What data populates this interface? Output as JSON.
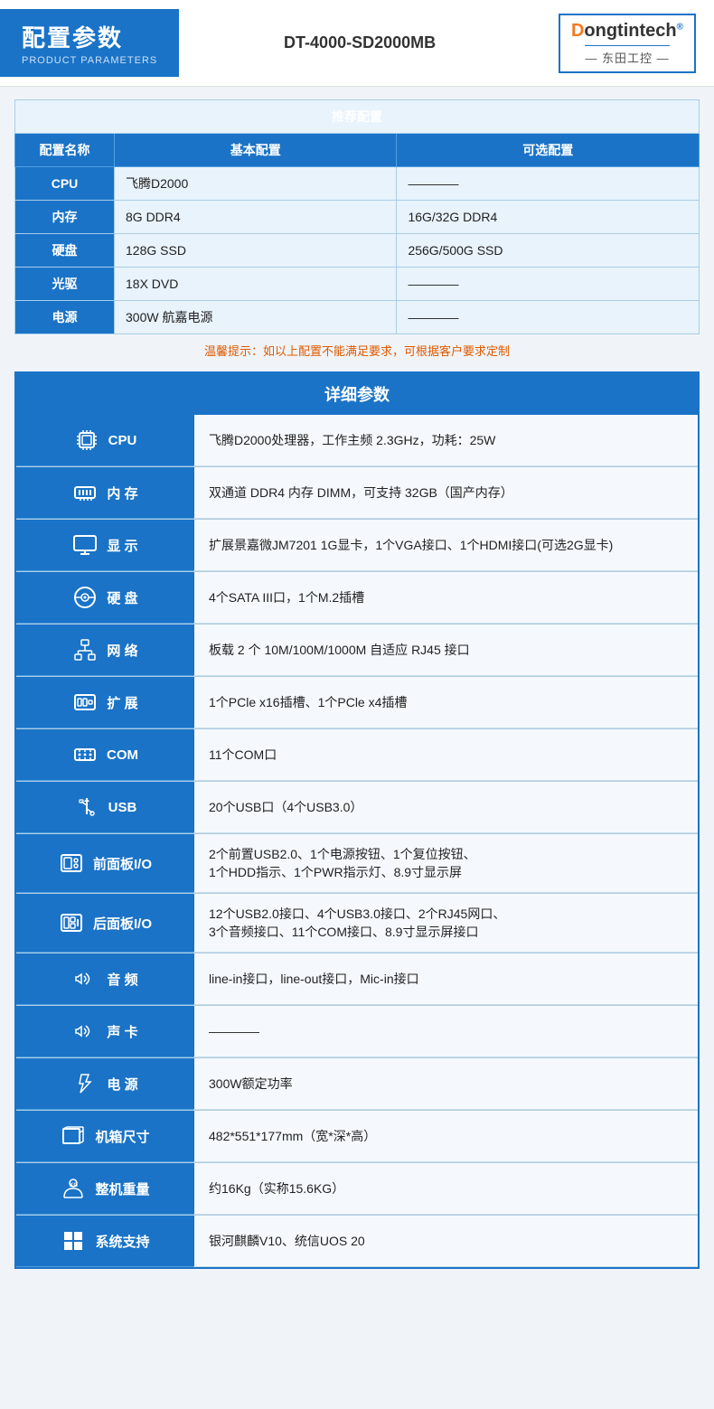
{
  "header": {
    "title_main": "配置参数",
    "title_sub": "PRODUCT PARAMETERS",
    "model": "DT-4000-SD2000MB",
    "logo_brand": "Dongtintech",
    "logo_brand_d": "D",
    "logo_chinese": "— 东田工控 —"
  },
  "recommended": {
    "section_title": "推荐配置",
    "columns": [
      "配置名称",
      "基本配置",
      "可选配置"
    ],
    "rows": [
      {
        "label": "CPU",
        "basic": "飞腾D2000",
        "optional": "————"
      },
      {
        "label": "内存",
        "basic": "8G DDR4",
        "optional": "16G/32G DDR4"
      },
      {
        "label": "硬盘",
        "basic": "128G SSD",
        "optional": "256G/500G SSD"
      },
      {
        "label": "光驱",
        "basic": "18X DVD",
        "optional": "————"
      },
      {
        "label": "电源",
        "basic": "300W 航嘉电源",
        "optional": "————"
      }
    ],
    "warm_tip": "温馨提示：如以上配置不能满足要求，可根据客户要求定制"
  },
  "detail": {
    "section_title": "详细参数",
    "rows": [
      {
        "label": "CPU",
        "icon": "cpu",
        "value": "飞腾D2000处理器，工作主频 2.3GHz，功耗：25W"
      },
      {
        "label": "内 存",
        "icon": "memory",
        "value": "双通道 DDR4 内存 DIMM，可支持 32GB（国产内存）"
      },
      {
        "label": "显 示",
        "icon": "display",
        "value": "扩展景嘉微JM7201 1G显卡，1个VGA接口、1个HDMI接口(可选2G显卡)"
      },
      {
        "label": "硬 盘",
        "icon": "harddisk",
        "value": "4个SATA III口，1个M.2插槽"
      },
      {
        "label": "网 络",
        "icon": "network",
        "value": "板载 2 个 10M/100M/1000M 自适应 RJ45 接口"
      },
      {
        "label": "扩 展",
        "icon": "expansion",
        "value": "1个PCle x16插槽、1个PCle x4插槽"
      },
      {
        "label": "COM",
        "icon": "com",
        "value": "11个COM口"
      },
      {
        "label": "USB",
        "icon": "usb",
        "value": "20个USB口（4个USB3.0）"
      },
      {
        "label": "前面板I/O",
        "icon": "frontpanel",
        "value_lines": [
          "2个前置USB2.0、1个电源按钮、1个复位按钮、",
          "1个HDD指示、1个PWR指示灯、8.9寸显示屏"
        ]
      },
      {
        "label": "后面板I/O",
        "icon": "rearpanel",
        "value_lines": [
          "12个USB2.0接口、4个USB3.0接口、2个RJ45网口、",
          "3个音频接口、11个COM接口、8.9寸显示屏接口"
        ]
      },
      {
        "label": "音 频",
        "icon": "audio",
        "value": "line-in接口，line-out接口，Mic-in接口"
      },
      {
        "label": "声 卡",
        "icon": "soundcard",
        "value": "————"
      },
      {
        "label": "电 源",
        "icon": "power",
        "value": "300W额定功率"
      },
      {
        "label": "机箱尺寸",
        "icon": "chassis",
        "value": "482*551*177mm（宽*深*高）"
      },
      {
        "label": "整机重量",
        "icon": "weight",
        "value": "约16Kg（实称15.6KG）"
      },
      {
        "label": "系统支持",
        "icon": "os",
        "value": "银河麒麟V10、统信UOS 20"
      }
    ]
  }
}
